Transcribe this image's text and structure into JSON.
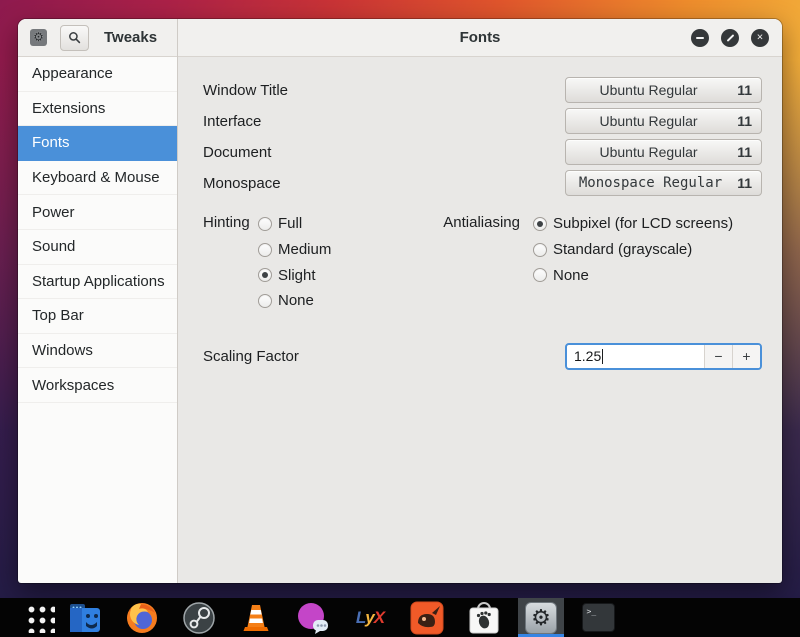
{
  "colors": {
    "accent": "#4a90d9",
    "selection_blue": "#4a90d9",
    "dock_indicator": "#3584e4",
    "header_bg": "#f1f0ee",
    "content_bg": "#e9e8e6"
  },
  "sidebar": {
    "title": "Tweaks",
    "items": [
      {
        "label": "Appearance",
        "selected": false
      },
      {
        "label": "Extensions",
        "selected": false
      },
      {
        "label": "Fonts",
        "selected": true
      },
      {
        "label": "Keyboard & Mouse",
        "selected": false
      },
      {
        "label": "Power",
        "selected": false
      },
      {
        "label": "Sound",
        "selected": false
      },
      {
        "label": "Startup Applications",
        "selected": false
      },
      {
        "label": "Top Bar",
        "selected": false
      },
      {
        "label": "Windows",
        "selected": false
      },
      {
        "label": "Workspaces",
        "selected": false
      }
    ]
  },
  "header": {
    "title": "Fonts",
    "close_glyph": "×"
  },
  "fonts": {
    "rows": [
      {
        "label": "Window Title",
        "font": "Ubuntu Regular",
        "size": "11"
      },
      {
        "label": "Interface",
        "font": "Ubuntu Regular",
        "size": "11"
      },
      {
        "label": "Document",
        "font": "Ubuntu Regular",
        "size": "11"
      },
      {
        "label": "Monospace",
        "font": "Monospace Regular",
        "size": "11"
      }
    ],
    "hinting": {
      "label": "Hinting",
      "options": [
        {
          "label": "Full",
          "selected": false
        },
        {
          "label": "Medium",
          "selected": false
        },
        {
          "label": "Slight",
          "selected": true
        },
        {
          "label": "None",
          "selected": false
        }
      ]
    },
    "antialiasing": {
      "label": "Antialiasing",
      "options": [
        {
          "label": "Subpixel (for LCD screens)",
          "selected": true
        },
        {
          "label": "Standard (grayscale)",
          "selected": false
        },
        {
          "label": "None",
          "selected": false
        }
      ]
    },
    "scaling": {
      "label": "Scaling Factor",
      "value": "1.25",
      "minus": "−",
      "plus": "+"
    }
  },
  "taskbar": {
    "lyx_label_1": "L",
    "lyx_label_2": "y",
    "lyx_label_3": "X",
    "terminal_prompt": ">_",
    "tweaks_glyph": "⚙"
  }
}
